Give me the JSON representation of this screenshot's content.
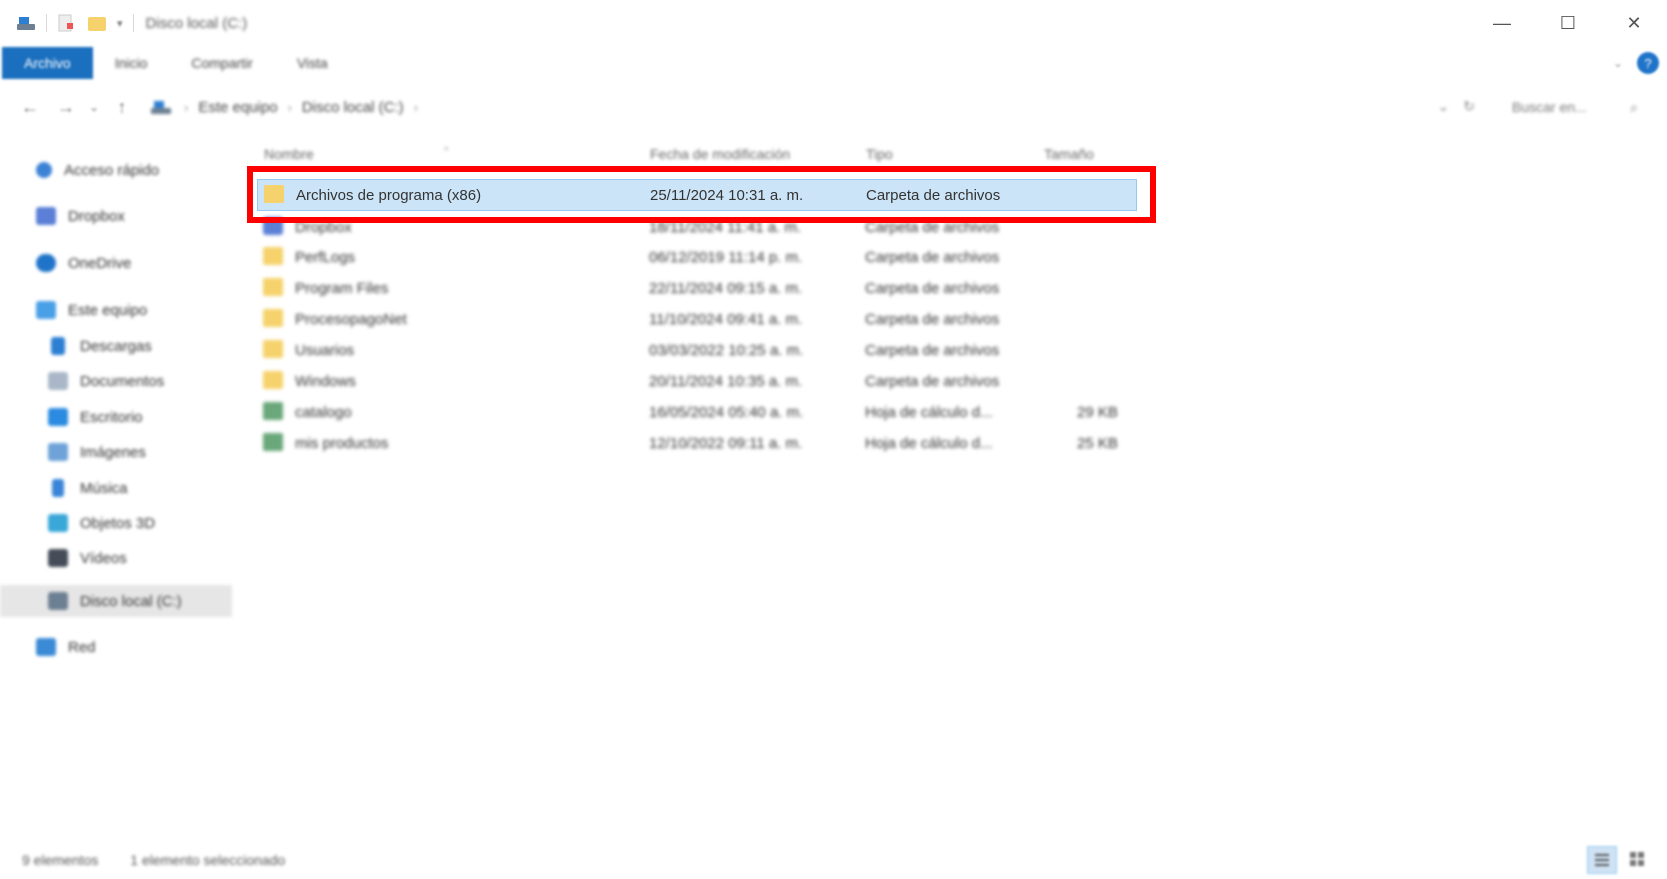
{
  "window": {
    "title": "Disco local (C:)",
    "controls": {
      "minimize": "—",
      "maximize": "☐",
      "close": "✕"
    }
  },
  "ribbon": {
    "tabs": [
      {
        "label": "Archivo",
        "active": true
      },
      {
        "label": "Inicio",
        "active": false
      },
      {
        "label": "Compartir",
        "active": false
      },
      {
        "label": "Vista",
        "active": false
      }
    ],
    "help": "?",
    "expand": "⌄"
  },
  "address": {
    "back": "←",
    "forward": "→",
    "recent": "⌄",
    "up": "↑",
    "crumbs": [
      "Este equipo",
      "Disco local (C:)"
    ],
    "separator": "›",
    "dropdown": "⌄",
    "refresh": "↻",
    "search_placeholder": "Buscar en...",
    "search_icon": "⌕"
  },
  "sidebar": {
    "items": [
      {
        "label": "Acceso rápido",
        "icon": "star-icon",
        "color": "#3b82d6"
      },
      {
        "label": "Dropbox",
        "icon": "dropbox-icon",
        "color": "#5b7fd6"
      },
      {
        "label": "OneDrive",
        "icon": "cloud-icon",
        "color": "#1f74c9"
      },
      {
        "label": "Este equipo",
        "icon": "computer-icon",
        "color": "#4aa0e6"
      },
      {
        "label": "Descargas",
        "icon": "download-icon",
        "color": "#2d7fd3"
      },
      {
        "label": "Documentos",
        "icon": "document-icon",
        "color": "#a9b7c8"
      },
      {
        "label": "Escritorio",
        "icon": "desktop-icon",
        "color": "#2b8be0"
      },
      {
        "label": "Imágenes",
        "icon": "pictures-icon",
        "color": "#6fa3d8"
      },
      {
        "label": "Música",
        "icon": "music-icon",
        "color": "#3a84d8"
      },
      {
        "label": "Objetos 3D",
        "icon": "cube-icon",
        "color": "#39a7d8"
      },
      {
        "label": "Vídeos",
        "icon": "video-icon",
        "color": "#444c57"
      },
      {
        "label": "Disco local (C:)",
        "icon": "drive-icon",
        "color": "#6d7f92",
        "selected": true
      },
      {
        "label": "Red",
        "icon": "network-icon",
        "color": "#3b8ad6"
      }
    ]
  },
  "table": {
    "columns": [
      "Nombre",
      "Fecha de modificación",
      "Tipo",
      "Tamaño"
    ],
    "sort_indicator": "^",
    "rows": [
      {
        "name": "Archivos de programa (x86)",
        "date": "25/11/2024 10:31 a. m.",
        "type": "Carpeta de archivos",
        "size": "",
        "icon": "folder-icon",
        "selected": true
      },
      {
        "name": "Dropbox",
        "date": "18/11/2024 11:41 a. m.",
        "type": "Carpeta de archivos",
        "size": "",
        "icon": "dropbox-folder-icon"
      },
      {
        "name": "PerfLogs",
        "date": "06/12/2019 11:14 p. m.",
        "type": "Carpeta de archivos",
        "size": "",
        "icon": "folder-icon"
      },
      {
        "name": "Program Files",
        "date": "22/11/2024 09:15 a. m.",
        "type": "Carpeta de archivos",
        "size": "",
        "icon": "folder-icon"
      },
      {
        "name": "ProcesopagoNet",
        "date": "11/10/2024 09:41 a. m.",
        "type": "Carpeta de archivos",
        "size": "",
        "icon": "folder-icon"
      },
      {
        "name": "Usuarios",
        "date": "03/03/2022 10:25 a. m.",
        "type": "Carpeta de archivos",
        "size": "",
        "icon": "folder-icon"
      },
      {
        "name": "Windows",
        "date": "20/11/2024 10:35 a. m.",
        "type": "Carpeta de archivos",
        "size": "",
        "icon": "folder-icon"
      },
      {
        "name": "catalogo",
        "date": "16/05/2024 05:40 a. m.",
        "type": "Hoja de cálculo d...",
        "size": "29 KB",
        "icon": "spreadsheet-icon"
      },
      {
        "name": "mis productos",
        "date": "12/10/2022 09:11 a. m.",
        "type": "Hoja de cálculo d...",
        "size": "25 KB",
        "icon": "spreadsheet-icon"
      }
    ]
  },
  "status": {
    "count": "9 elementos",
    "selection": "1 elemento seleccionado"
  },
  "colors": {
    "accent": "#1a6fbf",
    "selection_bg": "#cce4f7",
    "highlight_box": "#ff0000"
  }
}
